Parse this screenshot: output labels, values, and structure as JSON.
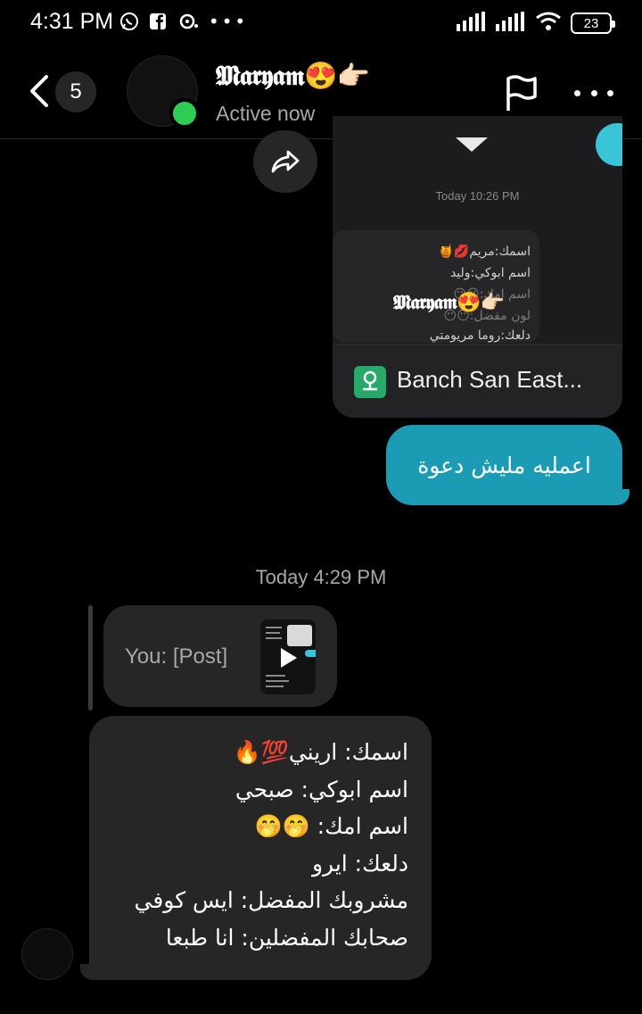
{
  "status_bar": {
    "time": "4:31 PM",
    "icons": [
      "whatsapp-icon",
      "facebook-icon",
      "notification-icon",
      "more-dots-icon",
      "signal-icon",
      "signal-icon",
      "wifi-icon"
    ],
    "battery": "23"
  },
  "header": {
    "back_icon": "chevron-left-icon",
    "unread_count": "5",
    "contact_name": "𝕸𝖆𝖗𝖞𝖆𝖒😍👉🏻",
    "status": "Active now",
    "flag_icon": "flag-icon",
    "more_icon": "more-horizontal-icon"
  },
  "shared_post": {
    "timestamp": "Today 10:26 PM",
    "thumb_lines": [
      "اسمك:مريم💋🍯",
      "اسم ابوكي:وليد",
      "اسم امك:😶😶",
      "لون مفضل:😶😶",
      "دلعك:روما مريومتي"
    ],
    "thumb_name": "𝕸𝖆𝖗𝖞𝖆𝖒😍👉🏻",
    "location_label": "Banch San East...",
    "location_icon": "map-pin-icon",
    "forward_icon": "share-forward-icon"
  },
  "sent_message": {
    "text": "اعمليه مليش دعوة",
    "color": "#1c9bb4"
  },
  "divider_timestamp": "Today 4:29 PM",
  "reply_ref": {
    "text": "You: [Post]",
    "play_icon": "play-icon"
  },
  "received_message": {
    "lines": [
      "اسمك: اريني💯🔥",
      "اسم ابوكي: صبحي",
      "اسم امك: 🤭🤭",
      "دلعك: ايرو",
      "مشروبك المفضل: ايس كوفي",
      "صحابك المفضلين: انا طبعا"
    ]
  },
  "colors": {
    "background": "#000000",
    "bubble_received": "#262626",
    "active_green": "#2ecc54",
    "accent_teal": "#39c4d8"
  }
}
